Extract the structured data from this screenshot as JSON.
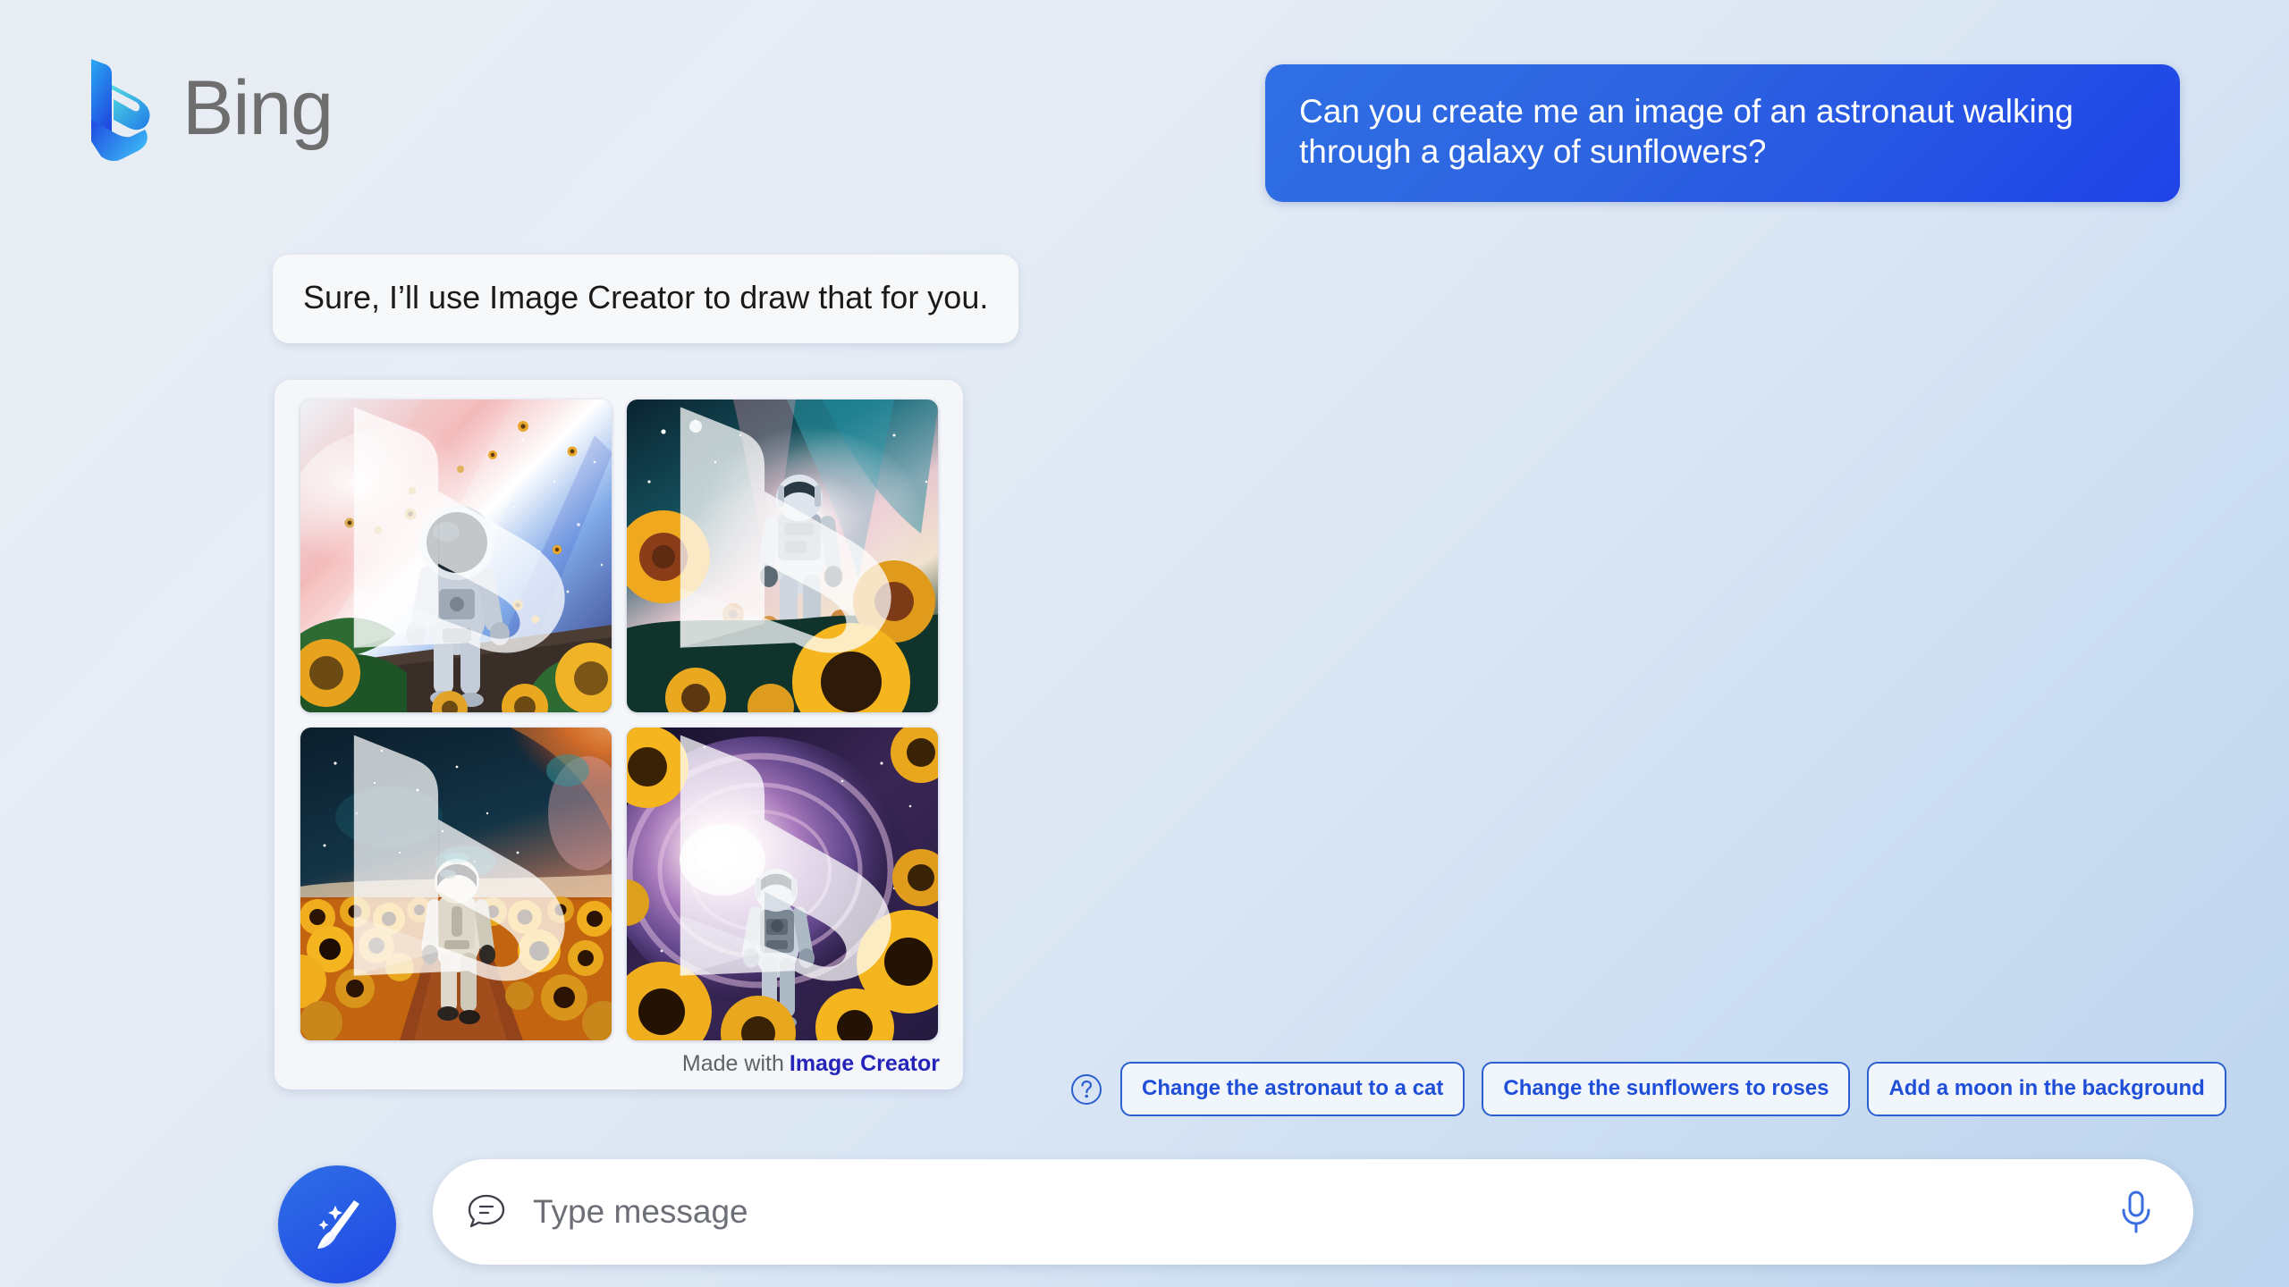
{
  "brand": {
    "name": "Bing",
    "logo_icon": "bing-logo-icon",
    "accent_blue": "#1f4fd8",
    "logo_gradient_start": "#33b6f5",
    "logo_gradient_end": "#1b4ae0",
    "text_gray": "#6e6e6e"
  },
  "conversation": {
    "user_message": {
      "text": "Can you create me an image of an astronaut walking through a galaxy of sunflowers?",
      "bubble_color": "#2a5ee2",
      "text_color": "#ffffff"
    },
    "assistant_message": {
      "text": "Sure, I’ll use Image Creator to draw that for you.",
      "bubble_color": "#f7f8fa",
      "text_color": "#1a1a1a"
    }
  },
  "image_card": {
    "attribution_prefix": "Made with",
    "attribution_link": "Image Creator",
    "attribution_link_color": "#2524b8",
    "watermark_icon": "bing-watermark-icon",
    "images": [
      {
        "alt": "Astronaut in white suit facing viewer, walking toward a pink and blue nebula with sunflowers and green leaves in the foreground",
        "name": "generated-image-1"
      },
      {
        "alt": "Astronaut seen from behind walking into a teal and pink galaxy above a field of large sunflowers",
        "name": "generated-image-2"
      },
      {
        "alt": "Astronaut walking a dirt path through a dense sunflower field under a dark starry sky with an orange nebula",
        "name": "generated-image-3"
      },
      {
        "alt": "Astronaut walking toward a glowing purple spiral galaxy framed by bright yellow sunflowers",
        "name": "generated-image-4"
      }
    ]
  },
  "suggestions": {
    "help_icon": "question-circle-icon",
    "chips": [
      "Change the astronaut to a cat",
      "Change the sunflowers to roses",
      "Add a moon in the background"
    ],
    "chip_text_color": "#1f4fd8",
    "chip_border_color": "#2b5fd0"
  },
  "composer": {
    "new_topic_icon": "broom-sparkle-icon",
    "chat_icon": "chat-bubble-icon",
    "input_placeholder": "Type message",
    "input_value": "",
    "mic_icon": "microphone-icon",
    "mic_color": "#3b6fe0"
  }
}
